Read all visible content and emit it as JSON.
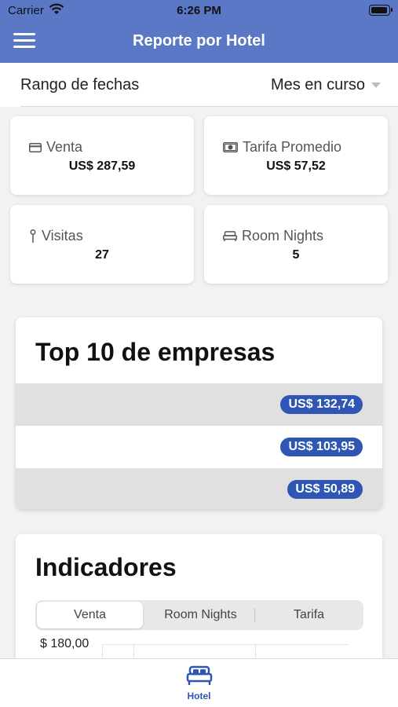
{
  "status_bar": {
    "carrier": "Carrier",
    "time": "6:26 PM"
  },
  "nav": {
    "title": "Reporte por Hotel"
  },
  "date_range": {
    "label": "Rango de fechas",
    "value": "Mes en curso"
  },
  "kpis": [
    {
      "icon": "credit-card-icon",
      "name": "Venta",
      "value": "US$ 287,59"
    },
    {
      "icon": "money-icon",
      "name": "Tarifa Promedio",
      "value": "US$ 57,52"
    },
    {
      "icon": "pin-icon",
      "name": "Visitas",
      "value": "27"
    },
    {
      "icon": "bed-icon",
      "name": "Room Nights",
      "value": "5"
    }
  ],
  "top10": {
    "title": "Top 10 de empresas",
    "rows": [
      {
        "company": "",
        "amount": "US$ 132,74"
      },
      {
        "company": "",
        "amount": "US$ 103,95"
      },
      {
        "company": "",
        "amount": "US$ 50,89"
      }
    ]
  },
  "indicators": {
    "title": "Indicadores",
    "segments": [
      "Venta",
      "Room Nights",
      "Tarifa"
    ],
    "selected_segment": "Venta",
    "y_tick_top": "$ 180,00"
  },
  "tab_bar": {
    "items": [
      {
        "label": "Hotel",
        "icon": "bed-icon"
      }
    ]
  },
  "colors": {
    "primary": "#5b78c7",
    "accent": "#2f56b4",
    "row_alt": "#e0e0e0"
  }
}
